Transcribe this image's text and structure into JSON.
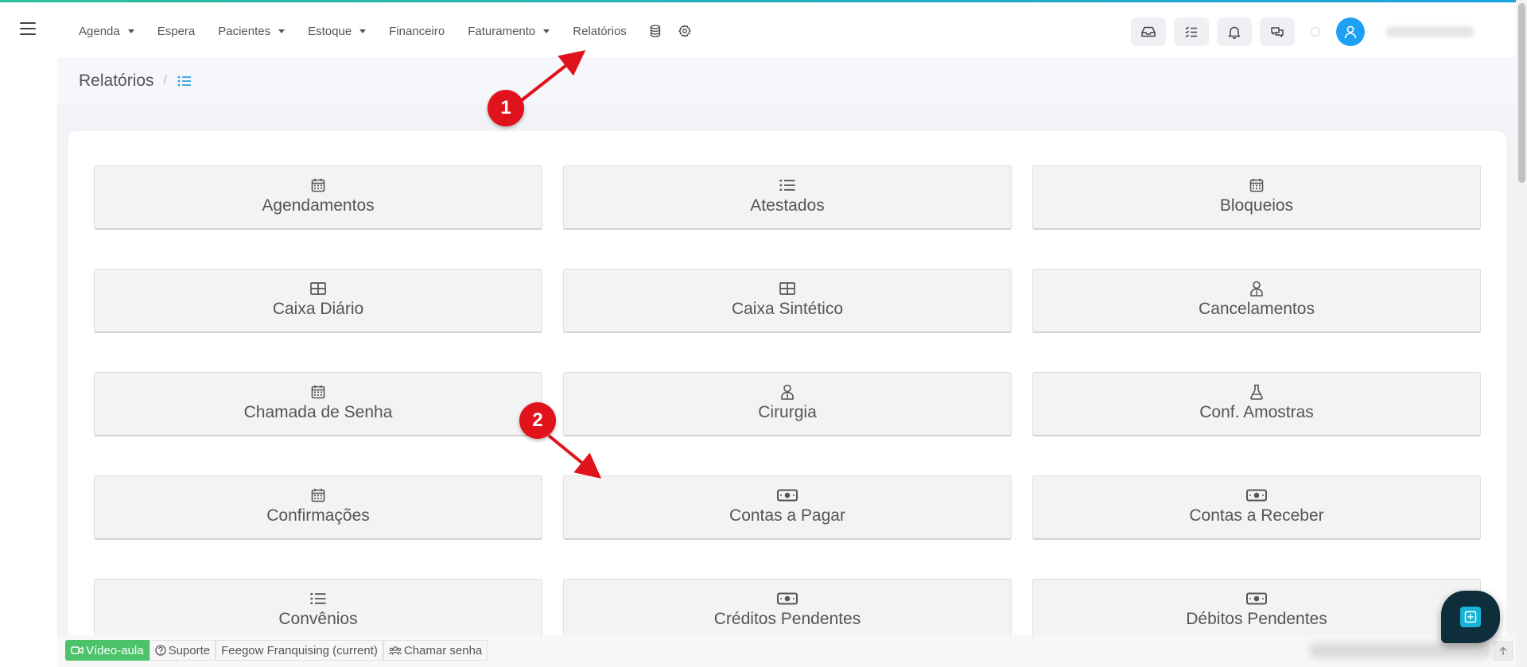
{
  "nav": {
    "items": [
      {
        "label": "Agenda",
        "dropdown": true
      },
      {
        "label": "Espera",
        "dropdown": false
      },
      {
        "label": "Pacientes",
        "dropdown": true
      },
      {
        "label": "Estoque",
        "dropdown": true
      },
      {
        "label": "Financeiro",
        "dropdown": false
      },
      {
        "label": "Faturamento",
        "dropdown": true
      },
      {
        "label": "Relatórios",
        "dropdown": false
      }
    ],
    "icons": [
      "database-icon",
      "gear-icon"
    ]
  },
  "topbar": {
    "buttons": [
      "inbox-icon",
      "checklist-icon",
      "bell-icon",
      "chat-icon"
    ],
    "avatar_icon": "user-icon",
    "accent_color": "#1ea1f2"
  },
  "breadcrumb": {
    "title": "Relatórios",
    "separator": "/",
    "list_icon": "list-icon"
  },
  "reports": [
    {
      "label": "Agendamentos",
      "icon": "calendar-icon"
    },
    {
      "label": "Atestados",
      "icon": "list-icon"
    },
    {
      "label": "Bloqueios",
      "icon": "calendar-icon"
    },
    {
      "label": "Caixa Diário",
      "icon": "table-icon"
    },
    {
      "label": "Caixa Sintético",
      "icon": "table-icon"
    },
    {
      "label": "Cancelamentos",
      "icon": "user-md-icon"
    },
    {
      "label": "Chamada de Senha",
      "icon": "calendar-icon"
    },
    {
      "label": "Cirurgia",
      "icon": "user-md-icon"
    },
    {
      "label": "Conf. Amostras",
      "icon": "flask-icon"
    },
    {
      "label": "Confirmações",
      "icon": "calendar-icon"
    },
    {
      "label": "Contas a Pagar",
      "icon": "money-icon"
    },
    {
      "label": "Contas a Receber",
      "icon": "money-icon"
    },
    {
      "label": "Convênios",
      "icon": "list-icon"
    },
    {
      "label": "Créditos Pendentes",
      "icon": "money-icon"
    },
    {
      "label": "Débitos Pendentes",
      "icon": "money-icon"
    }
  ],
  "annotations": [
    {
      "number": "1",
      "color": "#e0121b"
    },
    {
      "number": "2",
      "color": "#e0121b"
    }
  ],
  "footer": {
    "video_label": "Vídeo-aula",
    "support_label": "Suporte",
    "franchise_label": "Feegow Franquising (current)",
    "call_label": "Chamar senha",
    "video_color": "#4cc36a"
  }
}
